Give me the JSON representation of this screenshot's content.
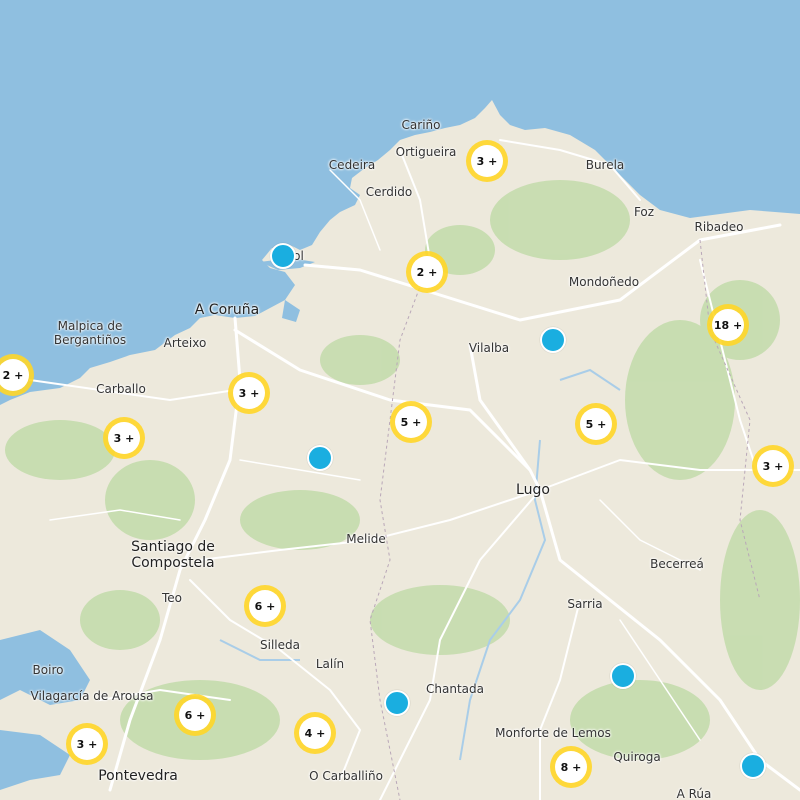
{
  "colors": {
    "sea": "#8fbfe0",
    "land": "#ede9dc",
    "forest": "#c2dbaa",
    "road": "#ffffff",
    "river": "#a9cde8",
    "cluster": "#ffd628",
    "pin": "#1aaee0"
  },
  "places": [
    {
      "id": "carino",
      "name": "Cariño"
    },
    {
      "id": "ortigueira",
      "name": "Ortigueira"
    },
    {
      "id": "cedeira",
      "name": "Cedeira"
    },
    {
      "id": "cerdido",
      "name": "Cerdido"
    },
    {
      "id": "burela",
      "name": "Burela"
    },
    {
      "id": "foz",
      "name": "Foz"
    },
    {
      "id": "ribadeo",
      "name": "Ribadeo"
    },
    {
      "id": "ferrol",
      "name": "Ferrol"
    },
    {
      "id": "mondonedo",
      "name": "Mondoñedo"
    },
    {
      "id": "acoruna",
      "name": "A Coruña"
    },
    {
      "id": "malpica",
      "name": "Malpica de Bergantiños"
    },
    {
      "id": "arteixo",
      "name": "Arteixo"
    },
    {
      "id": "vilalba",
      "name": "Vilalba"
    },
    {
      "id": "carballo",
      "name": "Carballo"
    },
    {
      "id": "lugo",
      "name": "Lugo"
    },
    {
      "id": "melide",
      "name": "Melide"
    },
    {
      "id": "santiago",
      "name": "Santiago de Compostela"
    },
    {
      "id": "becerrea",
      "name": "Becerreá"
    },
    {
      "id": "teo",
      "name": "Teo"
    },
    {
      "id": "sarria",
      "name": "Sarria"
    },
    {
      "id": "silleda",
      "name": "Silleda"
    },
    {
      "id": "lalin",
      "name": "Lalín"
    },
    {
      "id": "boiro",
      "name": "Boiro"
    },
    {
      "id": "chantada",
      "name": "Chantada"
    },
    {
      "id": "vilagarcia",
      "name": "Vilagarcía de Arousa"
    },
    {
      "id": "monforte",
      "name": "Monforte de Lemos"
    },
    {
      "id": "quiroga",
      "name": "Quiroga"
    },
    {
      "id": "pontevedra",
      "name": "Pontevedra"
    },
    {
      "id": "ocarballino",
      "name": "O Carballiño"
    },
    {
      "id": "arua",
      "name": "A Rúa"
    }
  ],
  "clusters": [
    {
      "id": "ortigueira-east",
      "label": "3 +"
    },
    {
      "id": "ferrol-east",
      "label": "2 +"
    },
    {
      "id": "ribadeo-south",
      "label": "18 +"
    },
    {
      "id": "malpica-south",
      "label": "2 +"
    },
    {
      "id": "arteixo-south",
      "label": "3 +"
    },
    {
      "id": "carballo-south",
      "label": "3 +"
    },
    {
      "id": "vilalba-south",
      "label": "5 +"
    },
    {
      "id": "lugo-northeast",
      "label": "5 +"
    },
    {
      "id": "becerrea-north",
      "label": "3 +"
    },
    {
      "id": "silleda-north",
      "label": "6 +"
    },
    {
      "id": "vilagarcia-east",
      "label": "6 +"
    },
    {
      "id": "pontevedra-north",
      "label": "3 +"
    },
    {
      "id": "ocarballino-north",
      "label": "4 +"
    },
    {
      "id": "quiroga-west",
      "label": "8 +"
    }
  ],
  "pins": [
    {
      "id": "ferrol-pin"
    },
    {
      "id": "vilalba-pin"
    },
    {
      "id": "santiago-north-pin"
    },
    {
      "id": "chantada-west-pin"
    },
    {
      "id": "sarria-south-pin"
    },
    {
      "id": "arua-pin"
    }
  ]
}
